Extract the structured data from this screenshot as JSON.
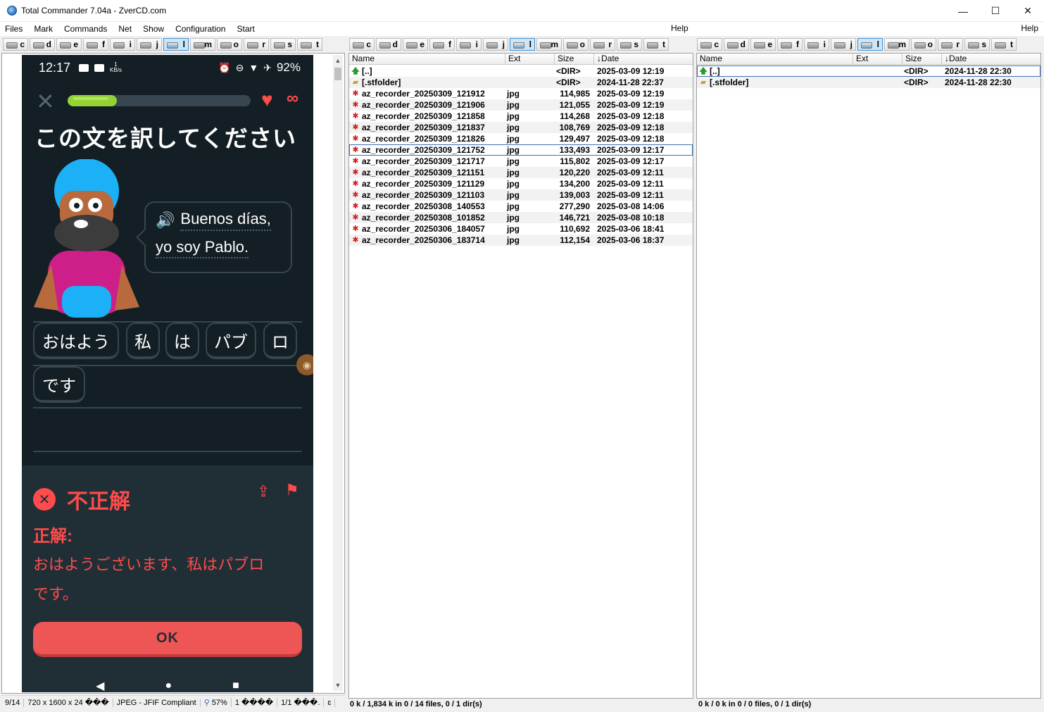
{
  "window": {
    "title": "Total Commander 7.04a - ZverCD.com",
    "minimize": "—",
    "maximize": "☐",
    "close": "✕"
  },
  "menu": {
    "items": [
      "Files",
      "Mark",
      "Commands",
      "Net",
      "Show",
      "Configuration",
      "Start"
    ],
    "help_left": "Help",
    "help_right": "Help"
  },
  "drives": [
    "c",
    "d",
    "e",
    "f",
    "i",
    "j",
    "l",
    "m",
    "o",
    "r",
    "s",
    "t"
  ],
  "active_drive": "l",
  "phone": {
    "time": "12:17",
    "net_speed": "1\nKB/s",
    "battery": "92%",
    "progress_fraction": 0.27,
    "prompt": "この文を訳してください",
    "speech_line1": "Buenos días,",
    "speech_line2": "yo soy Pablo.",
    "chips": [
      "おはよう",
      "私",
      "は",
      "パブ",
      "ロ",
      "です"
    ],
    "feedback_title": "不正解",
    "feedback_label": "正解:",
    "feedback_answer": "おはようございます、私はパブロです。",
    "ok_label": "OK"
  },
  "viewer_status": [
    "9/14",
    "720 x 1600 x 24 ���",
    "JPEG - JFIF Compliant",
    "57%",
    "1 ����",
    "1/1 ���.",
    "ɛ"
  ],
  "mid_panel": {
    "headers": {
      "name": "Name",
      "ext": "Ext",
      "size": "Size",
      "date": "↓Date"
    },
    "rows": [
      {
        "icon": "up",
        "name": "[..]",
        "ext": "",
        "size": "<DIR>",
        "date": "2025-03-09 12:19"
      },
      {
        "icon": "folder",
        "name": "[.stfolder]",
        "ext": "",
        "size": "<DIR>",
        "date": "2024-11-28 22:37"
      },
      {
        "icon": "file",
        "name": "az_recorder_20250309_121912",
        "ext": "jpg",
        "size": "114,985",
        "date": "2025-03-09 12:19"
      },
      {
        "icon": "file",
        "name": "az_recorder_20250309_121906",
        "ext": "jpg",
        "size": "121,055",
        "date": "2025-03-09 12:19"
      },
      {
        "icon": "file",
        "name": "az_recorder_20250309_121858",
        "ext": "jpg",
        "size": "114,268",
        "date": "2025-03-09 12:18"
      },
      {
        "icon": "file",
        "name": "az_recorder_20250309_121837",
        "ext": "jpg",
        "size": "108,769",
        "date": "2025-03-09 12:18"
      },
      {
        "icon": "file",
        "name": "az_recorder_20250309_121826",
        "ext": "jpg",
        "size": "129,497",
        "date": "2025-03-09 12:18"
      },
      {
        "icon": "file",
        "name": "az_recorder_20250309_121752",
        "ext": "jpg",
        "size": "133,493",
        "date": "2025-03-09 12:17",
        "cursor": true
      },
      {
        "icon": "file",
        "name": "az_recorder_20250309_121717",
        "ext": "jpg",
        "size": "115,802",
        "date": "2025-03-09 12:17"
      },
      {
        "icon": "file",
        "name": "az_recorder_20250309_121151",
        "ext": "jpg",
        "size": "120,220",
        "date": "2025-03-09 12:11"
      },
      {
        "icon": "file",
        "name": "az_recorder_20250309_121129",
        "ext": "jpg",
        "size": "134,200",
        "date": "2025-03-09 12:11"
      },
      {
        "icon": "file",
        "name": "az_recorder_20250309_121103",
        "ext": "jpg",
        "size": "139,003",
        "date": "2025-03-09 12:11"
      },
      {
        "icon": "file",
        "name": "az_recorder_20250308_140553",
        "ext": "jpg",
        "size": "277,290",
        "date": "2025-03-08 14:06"
      },
      {
        "icon": "file",
        "name": "az_recorder_20250308_101852",
        "ext": "jpg",
        "size": "146,721",
        "date": "2025-03-08 10:18"
      },
      {
        "icon": "file",
        "name": "az_recorder_20250306_184057",
        "ext": "jpg",
        "size": "110,692",
        "date": "2025-03-06 18:41"
      },
      {
        "icon": "file",
        "name": "az_recorder_20250306_183714",
        "ext": "jpg",
        "size": "112,154",
        "date": "2025-03-06 18:37"
      }
    ],
    "footer": "0 k / 1,834 k in 0 / 14 files, 0 / 1 dir(s)"
  },
  "right_panel": {
    "headers": {
      "name": "Name",
      "ext": "Ext",
      "size": "Size",
      "date": "↓Date"
    },
    "rows": [
      {
        "icon": "up",
        "name": "[..]",
        "ext": "",
        "size": "<DIR>",
        "date": "2024-11-28 22:30",
        "cursor": true
      },
      {
        "icon": "folder",
        "name": "[.stfolder]",
        "ext": "",
        "size": "<DIR>",
        "date": "2024-11-28 22:30"
      }
    ],
    "footer": "0 k / 0 k in 0 / 0 files, 0 / 1 dir(s)"
  }
}
